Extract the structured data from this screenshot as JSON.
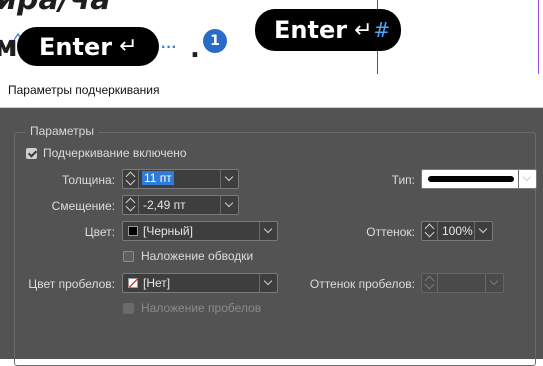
{
  "document": {
    "ghost_text": "ира/ча",
    "prefix_text": "м",
    "pill_left_label": "Enter",
    "pill_right_label": "Enter",
    "return_arrow": "↵",
    "hash_mark": "#",
    "dots": "···",
    "period": ".",
    "badge": "1"
  },
  "dialog": {
    "title": "Параметры подчеркивания",
    "group_title": "Параметры",
    "underline_on": {
      "label": "Подчеркивание включено",
      "checked": true
    },
    "weight": {
      "label": "Толщина:",
      "value": "11 пт"
    },
    "offset": {
      "label": "Смещение:",
      "value": "-2,49 пт"
    },
    "type": {
      "label": "Тип:"
    },
    "color": {
      "label": "Цвет:",
      "value": "[Черный]",
      "swatch": "#000000"
    },
    "tint": {
      "label": "Оттенок:",
      "value": "100%"
    },
    "overprint_stroke": {
      "label": "Наложение обводки",
      "checked": false
    },
    "gap_color": {
      "label": "Цвет пробелов:",
      "value": "[Нет]"
    },
    "gap_tint": {
      "label": "Оттенок пробелов:",
      "value": ""
    },
    "overprint_gap": {
      "label": "Наложение пробелов",
      "checked": false,
      "disabled": true
    }
  },
  "colors": {
    "dialog_bg": "#535353",
    "selection": "#2f7bd8",
    "guide": "#7a2bd6",
    "pill": "#000000",
    "badge": "#2a6bc7"
  }
}
